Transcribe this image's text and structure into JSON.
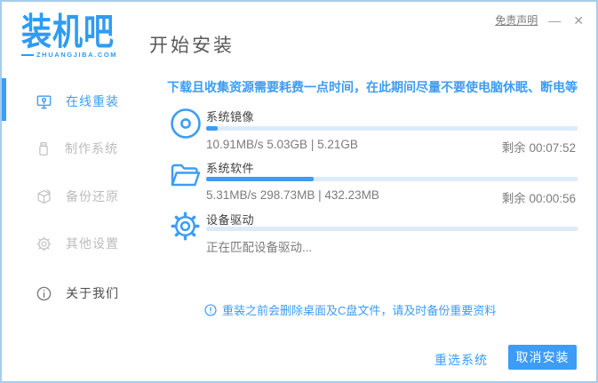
{
  "window": {
    "logo": {
      "brand": "装机吧",
      "domain": "ZHUANGJIBA.COM"
    },
    "titlebar": {
      "disclaimer": "免责声明",
      "minimize": "—",
      "close": "✕"
    },
    "page_title": "开始安装"
  },
  "sidebar": {
    "items": [
      {
        "label": "在线重装",
        "icon": "monitor-reinstall-icon",
        "state": "active"
      },
      {
        "label": "制作系统",
        "icon": "usb-drive-icon",
        "state": "disabled"
      },
      {
        "label": "备份还原",
        "icon": "backup-restore-icon",
        "state": "disabled"
      },
      {
        "label": "其他设置",
        "icon": "gear-icon",
        "state": "disabled"
      },
      {
        "label": "关于我们",
        "icon": "info-icon",
        "state": "normal"
      }
    ]
  },
  "main": {
    "notice": "下载且收集资源需要耗费一点时间，在此期间尽量不要使电脑休眠、断电等",
    "tasks": [
      {
        "name": "系统镜像",
        "icon": "disc-icon",
        "progress_percent": 3,
        "stats": "10.91MB/s 5.03GB | 5.21GB",
        "remaining": "剩余 00:07:52"
      },
      {
        "name": "系统软件",
        "icon": "folder-icon",
        "progress_percent": 29,
        "stats": "5.31MB/s 298.73MB | 432.23MB",
        "remaining": "剩余 00:00:56"
      },
      {
        "name": "设备驱动",
        "icon": "gear-icon",
        "progress_percent": 0,
        "status": "正在匹配设备驱动..."
      }
    ],
    "warning": "重装之前会删除桌面及C盘文件，请及时备份重要资料"
  },
  "footer": {
    "reselect_label": "重选系统",
    "cancel_label": "取消安装"
  },
  "colors": {
    "accent": "#3d9cf5",
    "progress_track": "#dcebfb",
    "window_border": "#a6cbec",
    "inactive_gray": "#bcbcbc",
    "text_gray": "#7c7c7c"
  }
}
